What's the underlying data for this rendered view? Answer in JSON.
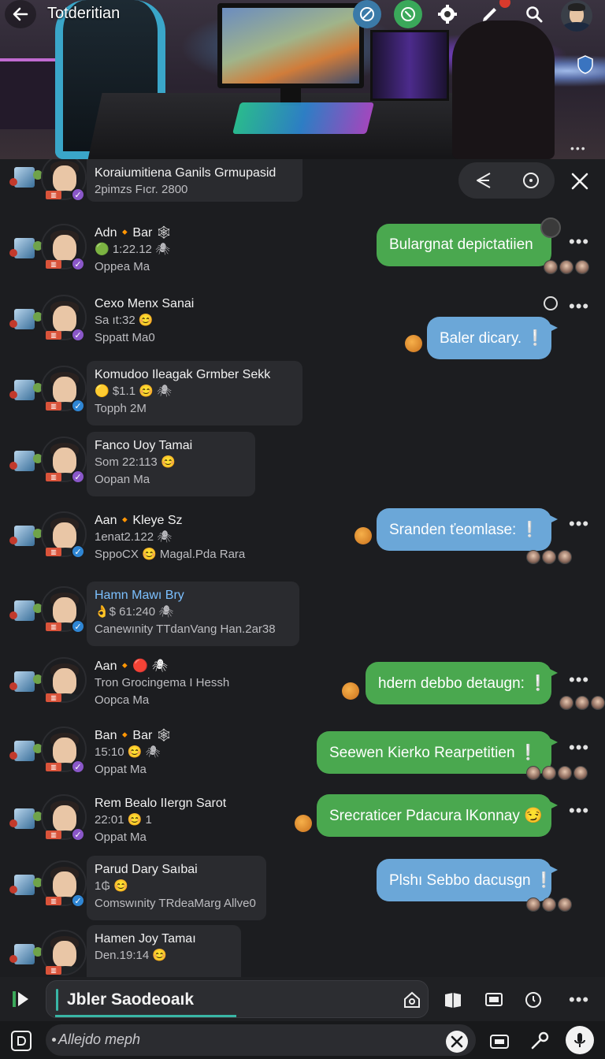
{
  "header": {
    "title": "Totderitian"
  },
  "group_header": {
    "name": "Koraiumitiena Ganils Grmupasid",
    "meta": "2pimzs Fıcr. 2800"
  },
  "conversations": [
    {
      "name": "Adn🔸Bar 🕸",
      "name_color": "white",
      "line2": "🟢 1:22.12 🕷",
      "line3": "Oppea Ma",
      "badge": "purple-check",
      "card": false
    },
    {
      "name": "Cexo Menx Sanai",
      "name_color": "mixed",
      "line2": "Sa ıt:32 😊",
      "line3": "Sppatt Ma0",
      "badge": "purple-check",
      "card": false
    },
    {
      "name": "Komudoo Ileagak Grmber Sekk",
      "name_color": "white",
      "line2": "🟡 $1.1 😊 🕷",
      "line3": "Topph 2M",
      "badge": "blue-check",
      "card": true
    },
    {
      "name": "Fanco Uoy Tamai",
      "name_color": "white",
      "line2": "Som 22:113 😊",
      "line3": "Oopan Ma",
      "badge": "purple-check",
      "card": true
    },
    {
      "name": "Aan🔸Kleye Sz",
      "name_color": "mixed",
      "line2": "1enat2.122 🕷",
      "line3": "SppoCX 😊 Magal.Pda Rara",
      "badge": "blue-check",
      "card": false
    },
    {
      "name": "Hamn Mawı Bry",
      "name_color": "blue",
      "line2": "👌$ 61:240 🕷",
      "line3": "Canewınity TTdanVang Han.2ar38",
      "badge": "blue-check",
      "card": true
    },
    {
      "name": "Aan🔸🔴 🕷",
      "name_color": "white",
      "line2": "Tron Grocingema I Hessh",
      "line3": "Oopca Ma",
      "badge": "none",
      "card": false
    },
    {
      "name": "Ban🔸Bar 🕸",
      "name_color": "white",
      "line2": "15:10 😊 🕷",
      "line3": "Oppat Ma",
      "badge": "purple-check",
      "card": false
    },
    {
      "name": "Rem Bealo IIergn Sarot",
      "name_color": "mixed",
      "line2": "22:01 😊 1",
      "line3": "Oppat Ma",
      "badge": "purple-check",
      "card": false
    },
    {
      "name": "Parud Dary Saıbai",
      "name_color": "white",
      "line2": "1₲ 😊",
      "line3": "Comswınity TRdeaMarg Allve0",
      "badge": "blue-check",
      "card": true
    },
    {
      "name": "Hamen Joy Tamaı",
      "name_color": "white",
      "line2": "Den.19:14 😊",
      "line3": "",
      "badge": "none",
      "card": true
    }
  ],
  "bubbles": [
    {
      "text": "Bulargnat depictatiien",
      "color": "green"
    },
    {
      "text": "Baler dicary. ❕",
      "color": "blue"
    },
    {
      "text": "Sranden ťeomlase: ❕",
      "color": "blue"
    },
    {
      "text": "hdern debbo detaugn: ❕",
      "color": "green"
    },
    {
      "text": "Seewen Kierko Rearpetitien ❕",
      "color": "green"
    },
    {
      "text": "Srecraticer Pdacura lKonnay 😏",
      "color": "green"
    },
    {
      "text": "Plshı Sebbo dacusgn ❕",
      "color": "blue"
    }
  ],
  "composer": {
    "value": "Jbler Saodeoaık"
  },
  "bottom_input": {
    "placeholder": "Allejdo meph"
  },
  "colors": {
    "background": "#1c1d20",
    "bubble_green": "#4aa84f",
    "bubble_blue": "#6ba7d8",
    "accent_teal": "#39b6a6",
    "check_blue": "#2f86d4",
    "check_purple": "#8a57c9"
  }
}
